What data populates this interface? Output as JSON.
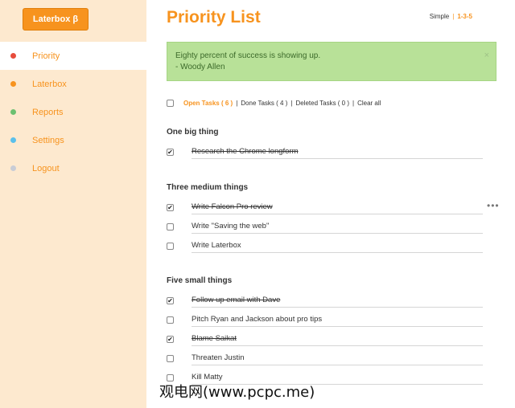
{
  "sidebar": {
    "brand": "Laterbox β",
    "items": [
      {
        "label": "Priority",
        "dot_color": "#e74c3c"
      },
      {
        "label": "Laterbox",
        "dot_color": "#f7931e"
      },
      {
        "label": "Reports",
        "dot_color": "#6cc070"
      },
      {
        "label": "Settings",
        "dot_color": "#5bc0eb"
      },
      {
        "label": "Logout",
        "dot_color": "#c8ccd6"
      }
    ]
  },
  "header": {
    "title": "Priority List",
    "mode_simple": "Simple",
    "mode_separator": "|",
    "mode_135": "1-3-5"
  },
  "quote": {
    "line1": "Eighty percent of success is showing up.",
    "line2": "- Woody Allen",
    "close_icon": "×"
  },
  "filters": {
    "open": "Open Tasks ( 6 )",
    "done": "Done Tasks ( 4 )",
    "deleted": "Deleted Tasks ( 0 )",
    "clear": "Clear all",
    "separator": "|"
  },
  "sections": [
    {
      "title": "One big thing",
      "tasks": [
        {
          "text": "Research the Chrome longform",
          "done": true
        }
      ]
    },
    {
      "title": "Three medium things",
      "tasks": [
        {
          "text": "Write Falcon Pro review",
          "done": true
        },
        {
          "text": "Write \"Saving the web\"",
          "done": false
        },
        {
          "text": "Write Laterbox",
          "done": false
        }
      ]
    },
    {
      "title": "Five small things",
      "tasks": [
        {
          "text": "Follow up email with Dave",
          "done": true
        },
        {
          "text": "Pitch Ryan and Jackson about pro tips",
          "done": false
        },
        {
          "text": "Blame Saikat",
          "done": true
        },
        {
          "text": "Threaten Justin",
          "done": false
        },
        {
          "text": "Kill Matty",
          "done": false
        }
      ]
    }
  ],
  "task_menu_icon": "•••",
  "checkmark": "✔",
  "watermark": "观电网(www.pcpc.me)"
}
